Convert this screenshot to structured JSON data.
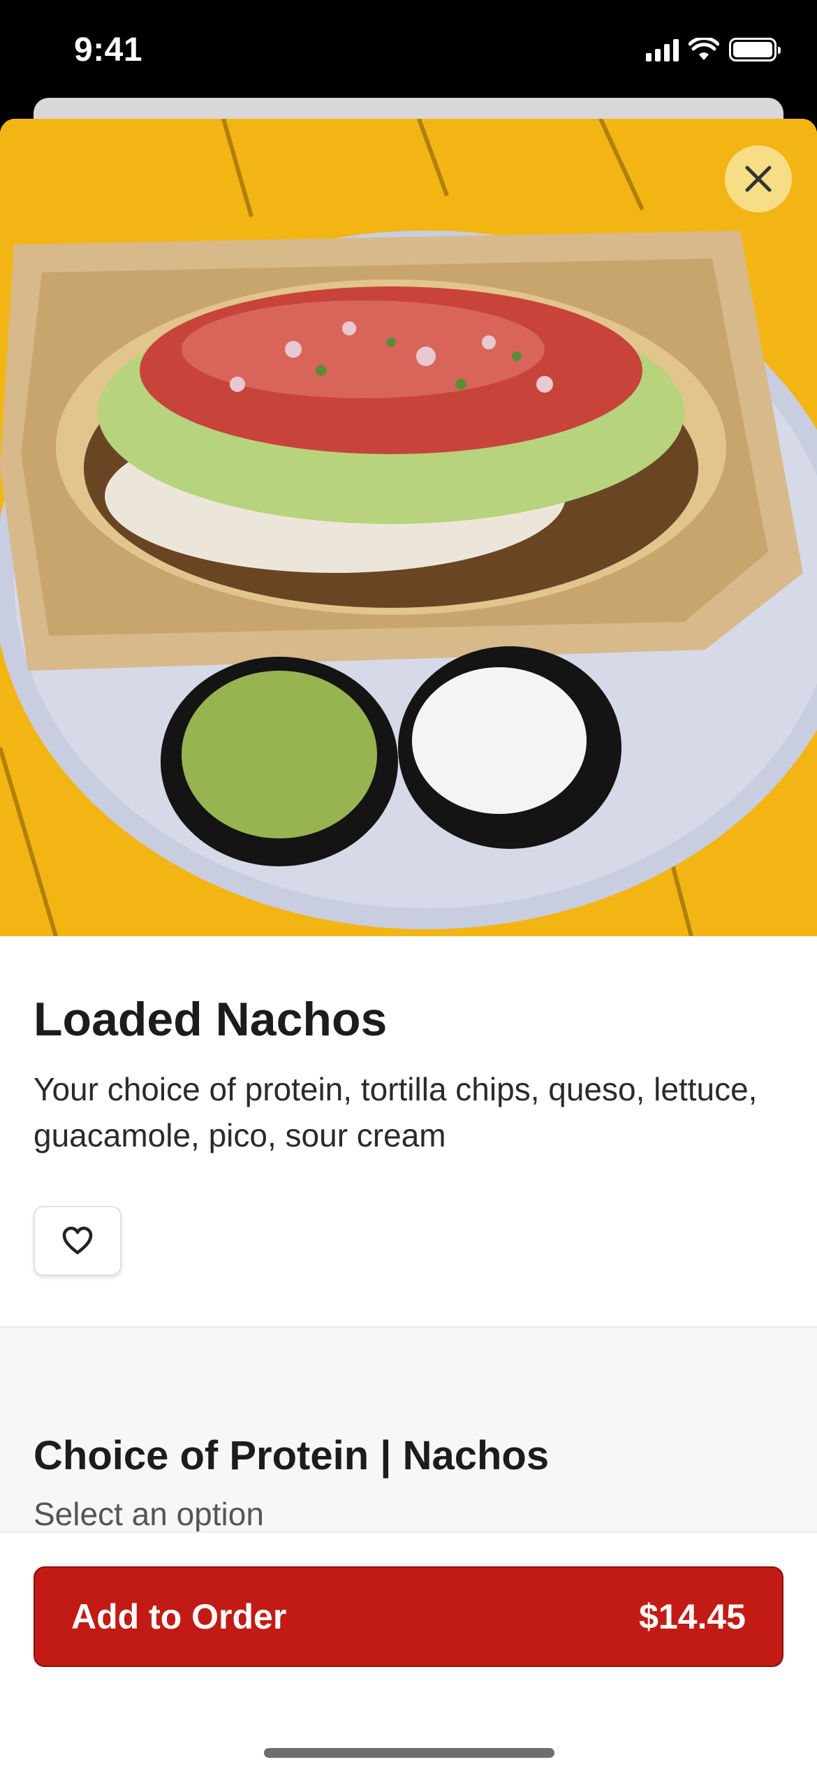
{
  "status_bar": {
    "time": "9:41",
    "icons": [
      "cellular-signal-icon",
      "wifi-icon",
      "battery-icon"
    ]
  },
  "hero": {
    "image": "nachos-photo",
    "close_icon": "close-icon"
  },
  "item": {
    "title": "Loaded Nachos",
    "description": "Your choice of protein, tortilla chips, queso, lettuce, guacamole, pico, sour cream",
    "favorite_icon": "heart-icon"
  },
  "options": {
    "title": "Choice of Protein | Nachos",
    "subtitle": "Select an option"
  },
  "footer": {
    "add_label": "Add to Order",
    "price": "$14.45"
  },
  "colors": {
    "accent": "#c21b15",
    "hero_background": "#f2b514",
    "close_button": "#f6dd86"
  }
}
